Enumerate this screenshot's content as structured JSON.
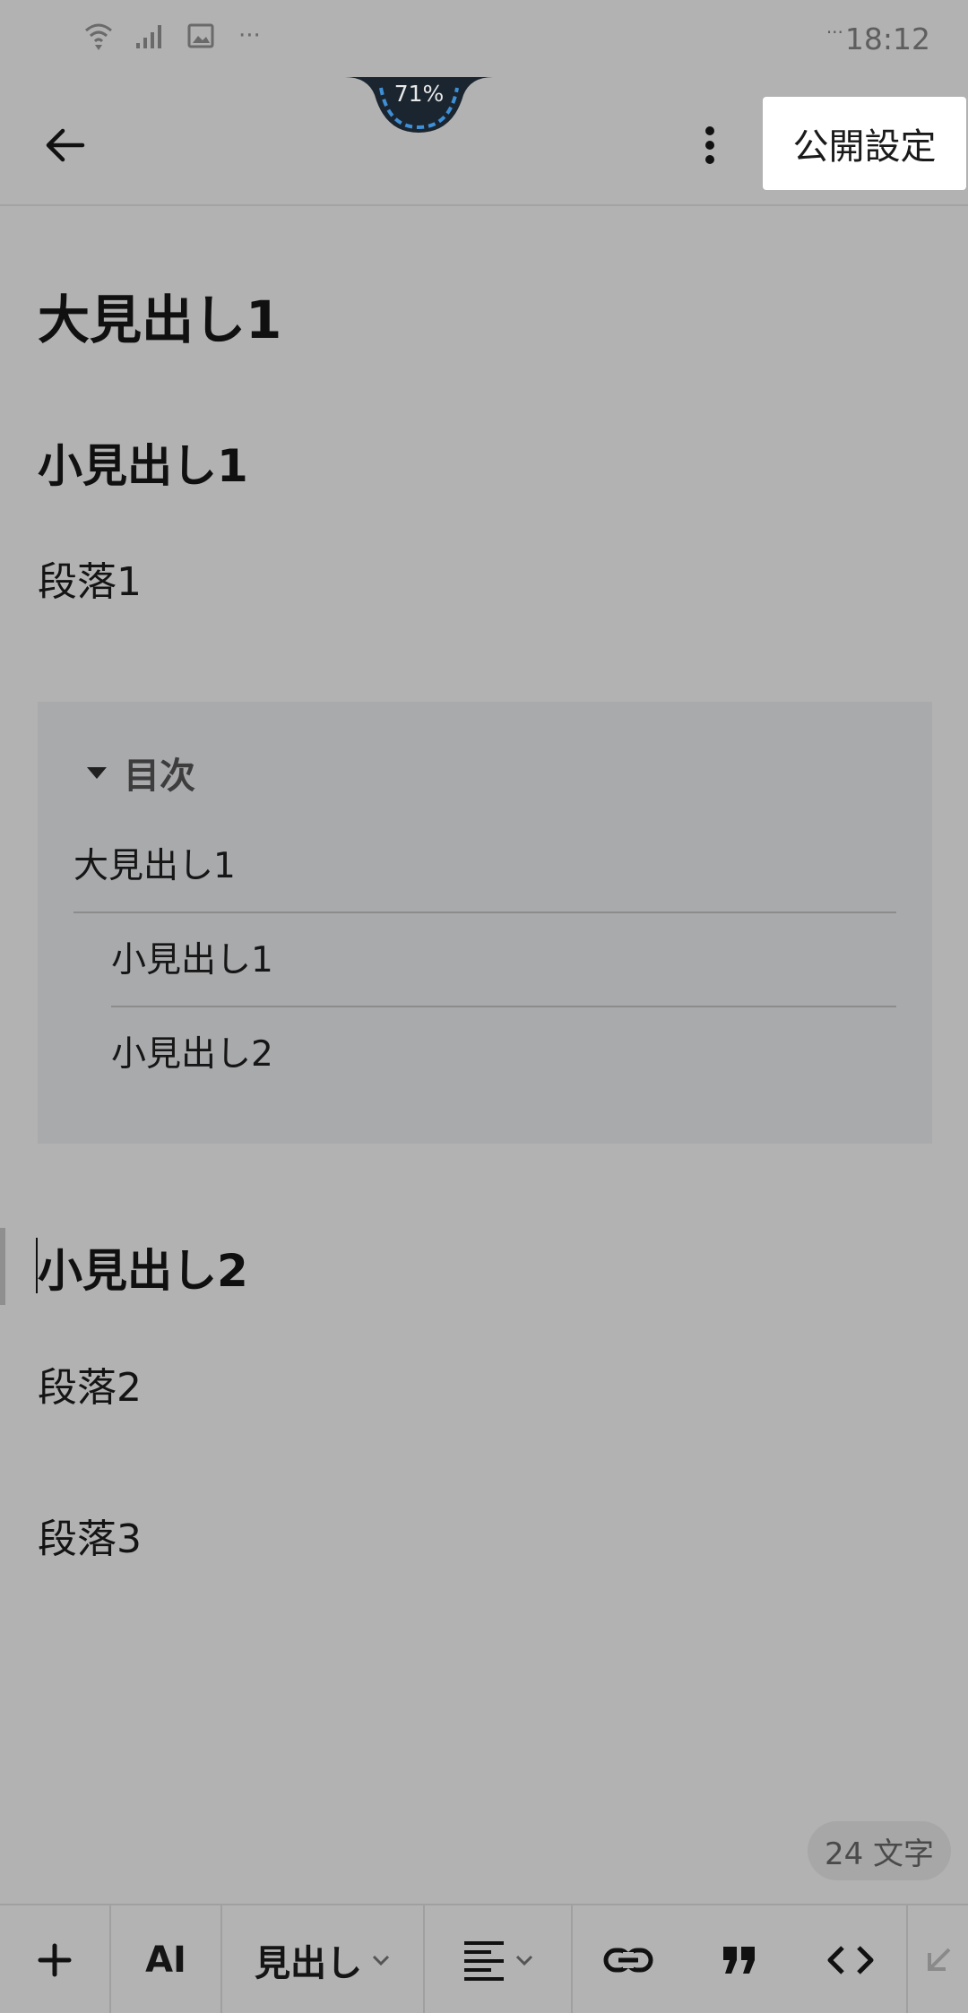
{
  "status_bar": {
    "time": "18:12",
    "time_prefix": "···",
    "more_indicator": "···",
    "icons": [
      "wifi-icon",
      "signal-icon",
      "image-icon"
    ],
    "battery_percent": "71%"
  },
  "app_bar": {
    "back_icon": "arrow-left-icon",
    "more_icon": "more-vertical-icon",
    "publish_label": "公開設定"
  },
  "editor": {
    "heading_large_1": "大見出し1",
    "heading_small_1": "小見出し1",
    "paragraph_1": "段落1",
    "toc": {
      "title": "目次",
      "items": [
        {
          "label": "大見出し1",
          "level": 1
        },
        {
          "label": "小見出し1",
          "level": 2
        },
        {
          "label": "小見出し2",
          "level": 2
        }
      ]
    },
    "heading_small_2": "小見出し2",
    "paragraph_2": "段落2",
    "paragraph_3": "段落3"
  },
  "char_count": "24 文字",
  "toolbar": {
    "add_icon": "plus-icon",
    "ai_label": "AI",
    "heading_label": "見出し",
    "align_icon": "align-left-icon",
    "link_icon": "link-icon",
    "quote_icon": "quote-icon",
    "code_icon": "code-icon",
    "collapse_icon": "keyboard-hide-icon"
  },
  "colors": {
    "overlay_background": "#b2b2b2",
    "toc_background": "#a9aaac",
    "publish_button_bg": "#ffffff",
    "battery_ring": "#3f8fd6"
  }
}
